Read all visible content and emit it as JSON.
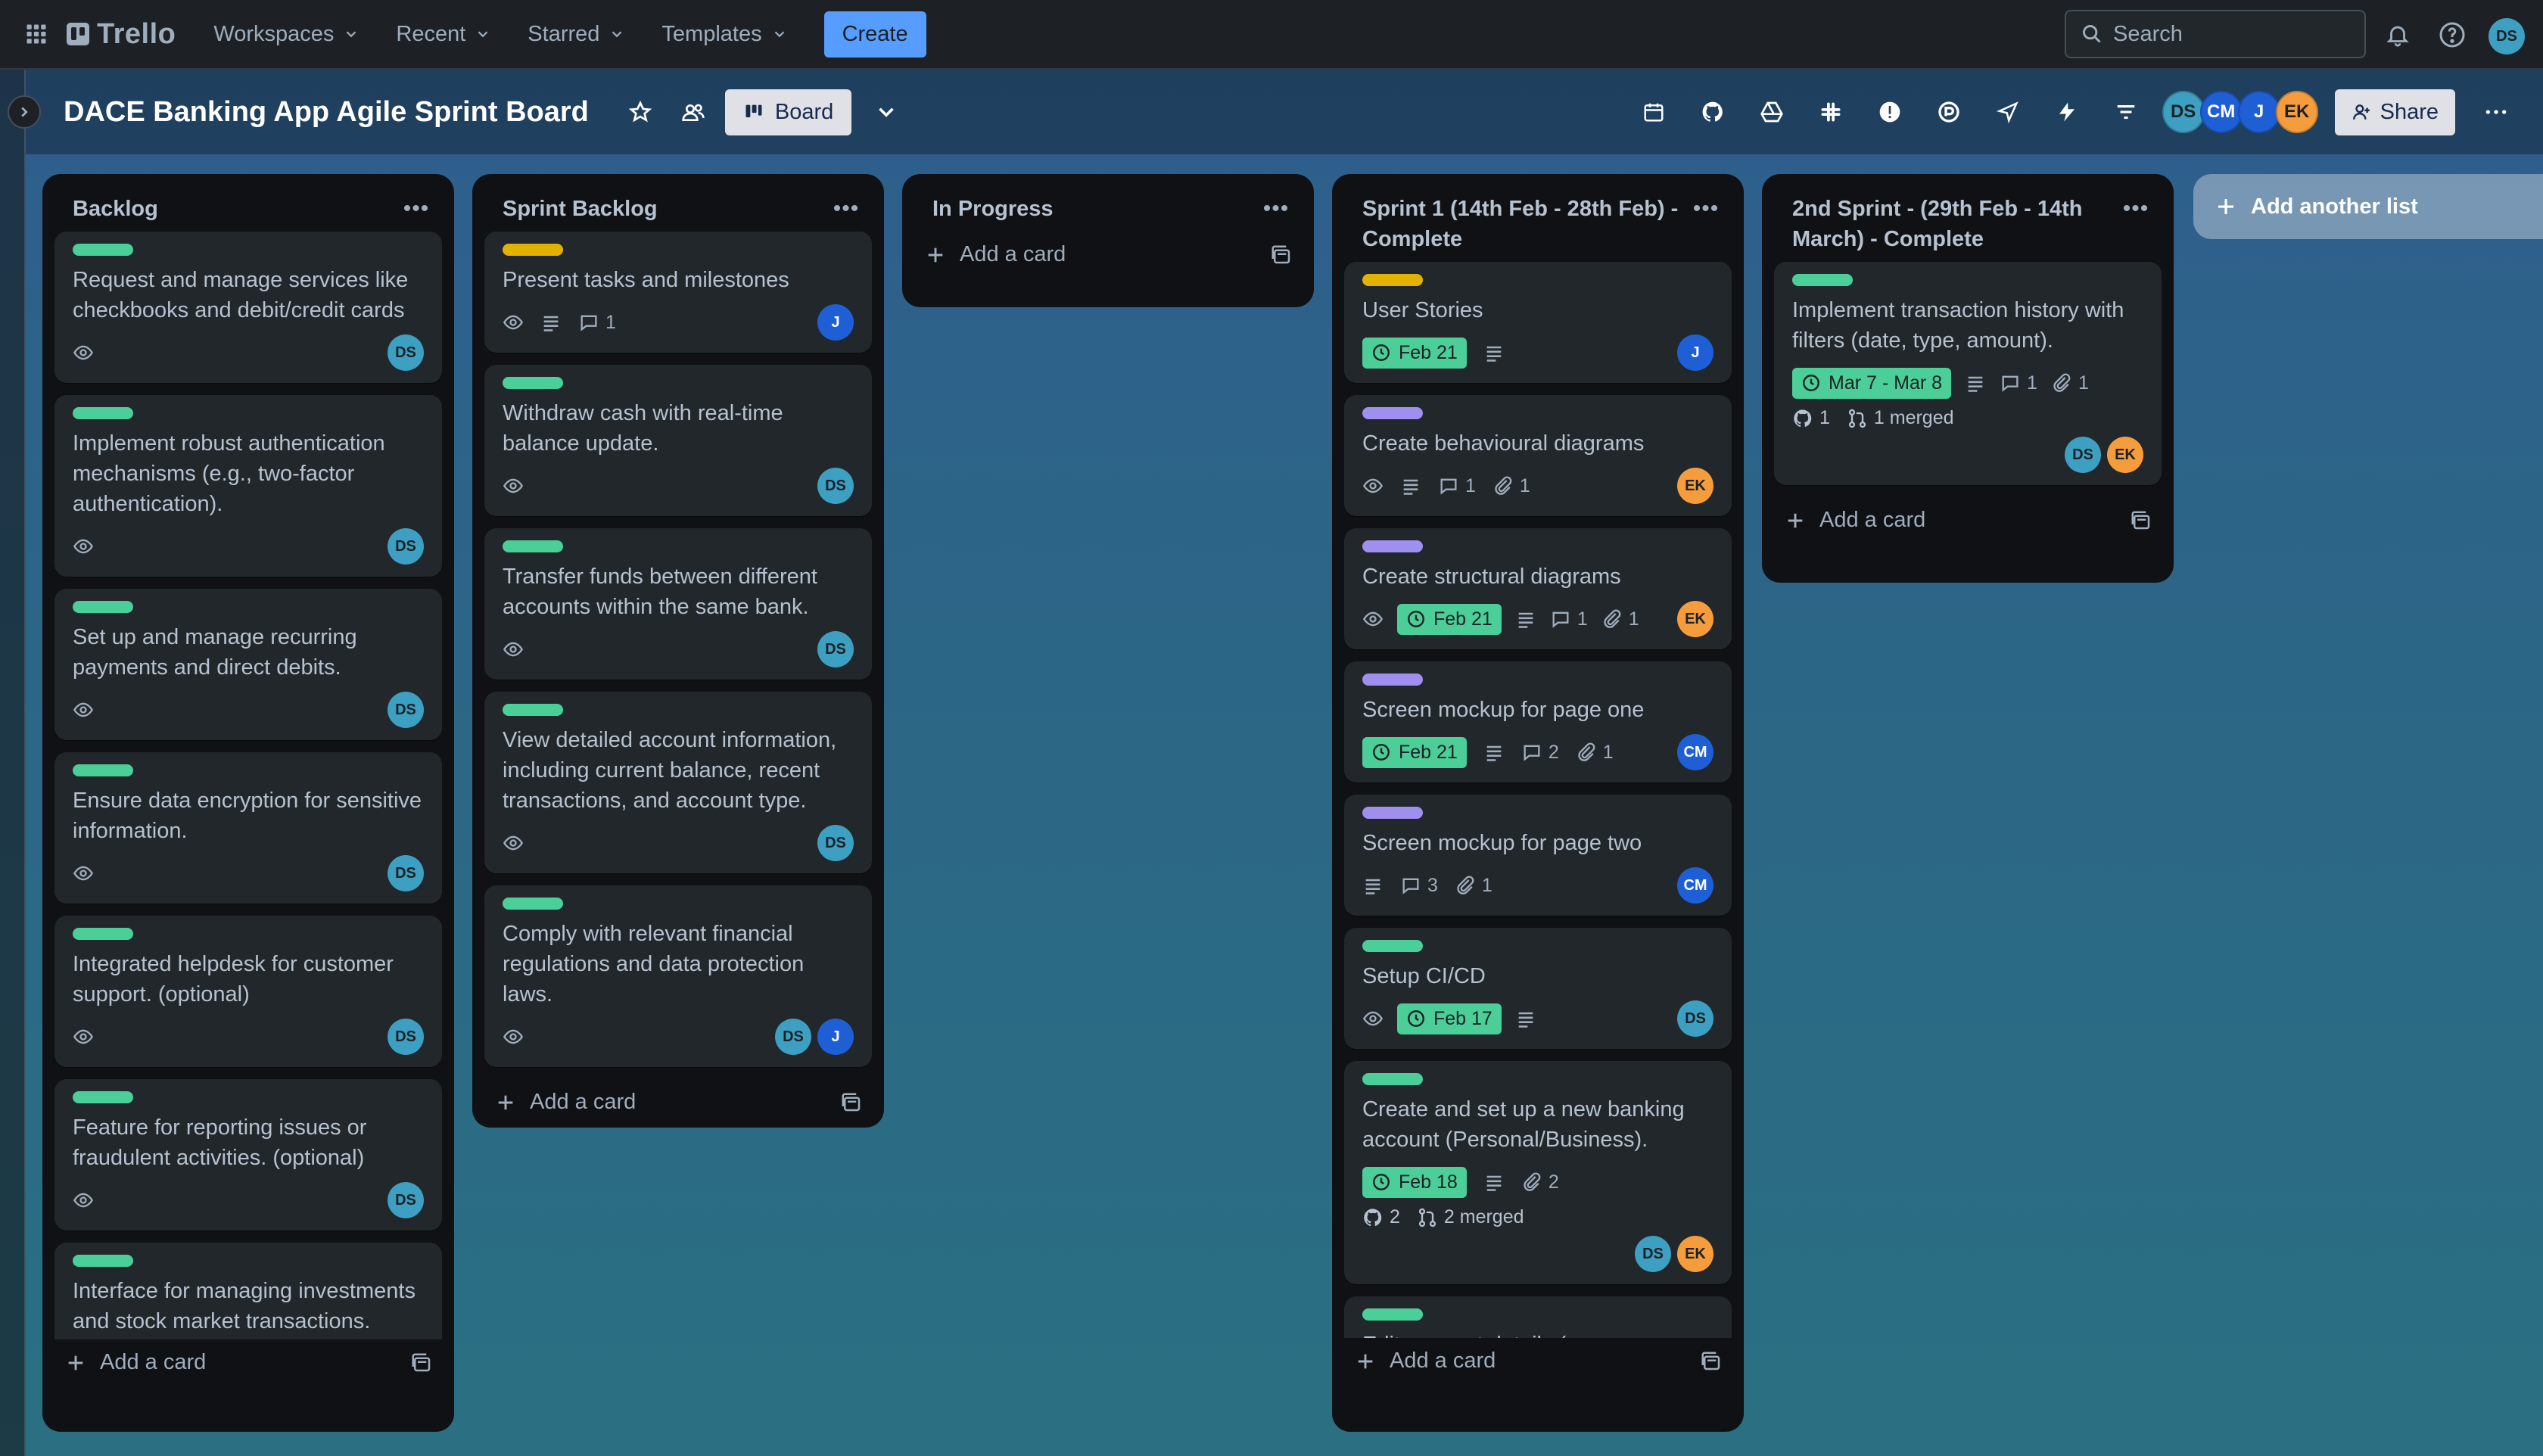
{
  "nav": {
    "logo": "Trello",
    "menu": [
      "Workspaces",
      "Recent",
      "Starred",
      "Templates"
    ],
    "create": "Create",
    "search_placeholder": "Search",
    "user_initials": "DS"
  },
  "board": {
    "title": "DACE Banking App Agile Sprint Board",
    "view_label": "Board",
    "share_label": "Share",
    "members": [
      "DS",
      "CM",
      "J",
      "EK"
    ]
  },
  "add_list_label": "Add another list",
  "add_card_label": "Add a card",
  "colors": {
    "label_green": "#4bce97",
    "label_yellow": "#e2b203",
    "label_purple": "#9f8fef",
    "avatar_ds": "#3d9fc1",
    "avatar_blue": "#1e5fd6",
    "avatar_ek": "#f59d3d",
    "create_button": "#579dff"
  },
  "lists": {
    "backlog": {
      "title": "Backlog",
      "cards": [
        {
          "title": "Request and manage services like checkbooks and debit/credit cards",
          "member": "DS"
        },
        {
          "title": "Implement robust authentication mechanisms (e.g., two-factor authentication).",
          "member": "DS"
        },
        {
          "title": "Set up and manage recurring payments and direct debits.",
          "member": "DS"
        },
        {
          "title": "Ensure data encryption for sensitive information.",
          "member": "DS"
        },
        {
          "title": "Integrated helpdesk for customer support. (optional)",
          "member": "DS"
        },
        {
          "title": "Feature for reporting issues or fraudulent activities. (optional)",
          "member": "DS"
        },
        {
          "title": "Interface for managing investments and stock market transactions. (optional)",
          "member": "DS"
        }
      ]
    },
    "sprint_backlog": {
      "title": "Sprint Backlog",
      "cards": [
        {
          "title": "Present tasks and milestones",
          "comments": "1",
          "member": "J"
        },
        {
          "title": "Withdraw cash with real-time balance update.",
          "member": "DS"
        },
        {
          "title": "Transfer funds between different accounts within the same bank.",
          "member": "DS"
        },
        {
          "title": "View detailed account information, including current balance, recent transactions, and account type.",
          "member": "DS"
        },
        {
          "title": "Comply with relevant financial regulations and data protection laws.",
          "members": [
            "DS",
            "J"
          ]
        }
      ]
    },
    "in_progress": {
      "title": "In Progress"
    },
    "sprint1": {
      "title": "Sprint 1 (14th Feb - 28th Feb) - Complete",
      "cards": [
        {
          "title": "User Stories",
          "date": "Feb 21",
          "member": "J"
        },
        {
          "title": "Create behavioural diagrams",
          "comments": "1",
          "attachments": "1",
          "member": "EK"
        },
        {
          "title": "Create structural diagrams",
          "date": "Feb 21",
          "comments": "1",
          "attachments": "1",
          "member": "EK"
        },
        {
          "title": "Screen mockup for page one",
          "date": "Feb 21",
          "comments": "2",
          "attachments": "1",
          "member": "CM"
        },
        {
          "title": "Screen mockup for page two",
          "comments": "3",
          "attachments": "1",
          "member": "CM"
        },
        {
          "title": "Setup CI/CD",
          "date": "Feb 17",
          "member": "DS"
        },
        {
          "title": "Create and set up a new banking account (Personal/Business).",
          "date": "Feb 18",
          "attachments": "2",
          "github": "2",
          "merged": "2 merged",
          "members": [
            "DS",
            "EK"
          ]
        },
        {
          "title": "Edit account details (e.g., user information, account type)"
        }
      ]
    },
    "sprint2": {
      "title": "2nd Sprint - (29th Feb - 14th March) - Complete",
      "cards": [
        {
          "title": "Implement transaction history with filters (date, type, amount).",
          "date": "Mar 7 - Mar 8",
          "comments": "1",
          "attachments": "1",
          "github": "1",
          "merged": "1 merged",
          "members": [
            "DS",
            "EK"
          ]
        }
      ]
    }
  }
}
